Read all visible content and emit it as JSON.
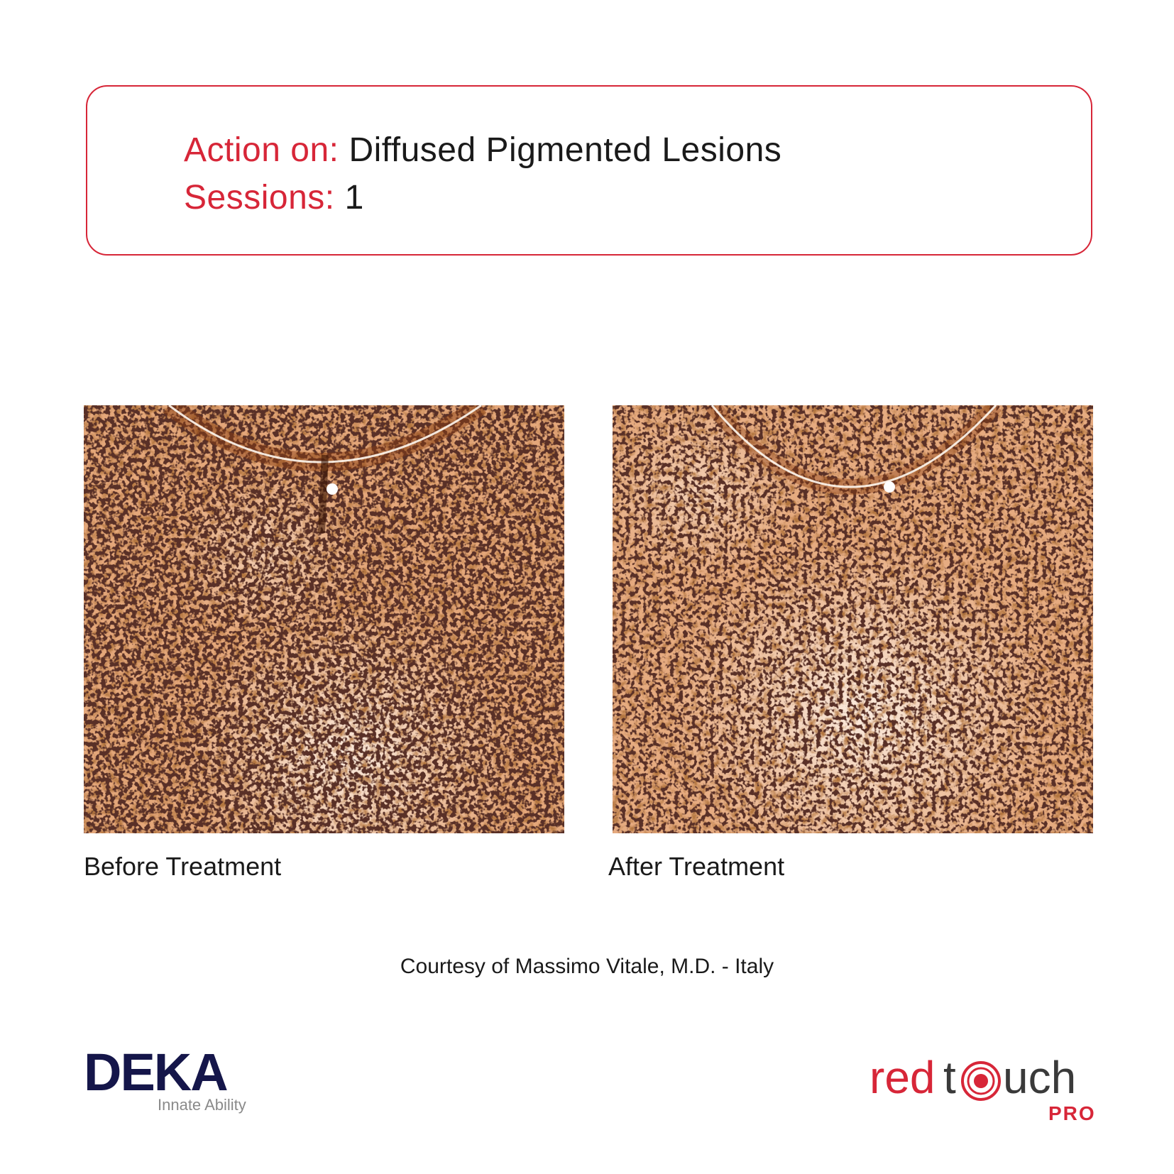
{
  "info": {
    "action_label": "Action on:",
    "action_value": "Diffused Pigmented Lesions",
    "sessions_label": "Sessions:",
    "sessions_value": "1"
  },
  "images": {
    "before_caption": "Before Treatment",
    "after_caption": "After Treatment"
  },
  "courtesy": "Courtesy of Massimo Vitale, M.D. - Italy",
  "logos": {
    "deka": {
      "wordmark": "DEKA",
      "tagline": "Innate Ability"
    },
    "redtouch": {
      "word_red": "red",
      "word_rest": "uch",
      "suffix": "PRO"
    }
  },
  "colors": {
    "accent_red": "#d72638",
    "deka_navy": "#15164a",
    "deka_lavender": "#8c86c0",
    "skin_tone": "#d08a55"
  }
}
